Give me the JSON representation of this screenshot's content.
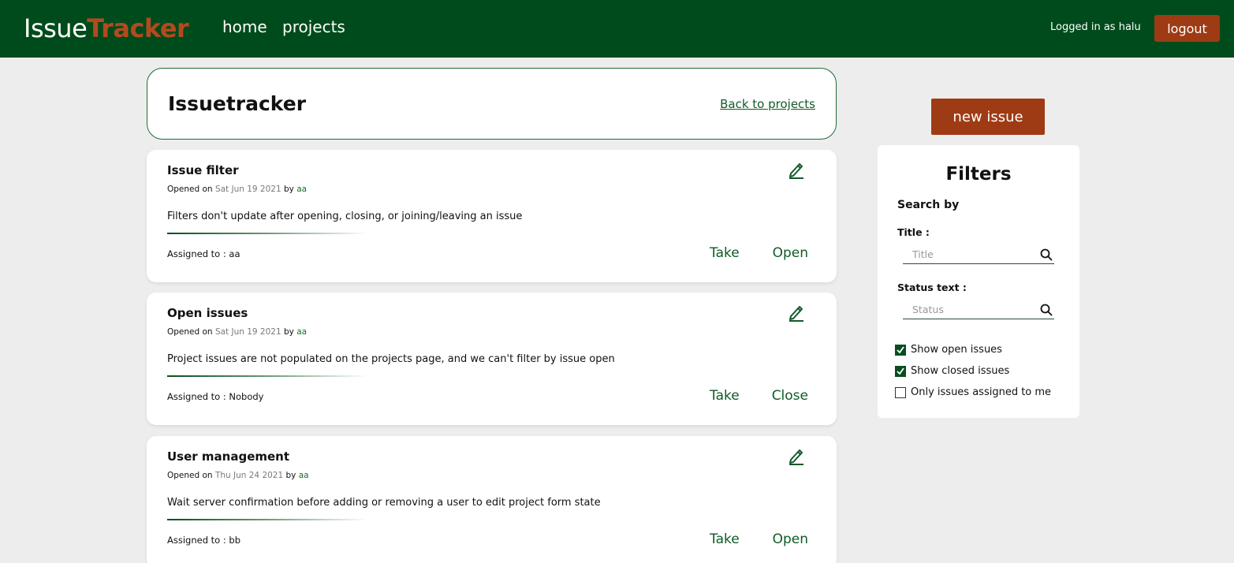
{
  "header": {
    "brand_part1": "Issue",
    "brand_part2": "Tracker",
    "nav": {
      "home": "home",
      "projects": "projects"
    },
    "logged_in_text": "Logged in as halu",
    "logout_label": "logout"
  },
  "title_card": {
    "title": "Issuetracker",
    "back_link": "Back to projects"
  },
  "issues": [
    {
      "title": "Issue filter",
      "opened_prefix": "Opened on ",
      "date": "Sat Jun 19 2021",
      "by": " by ",
      "author": "aa",
      "description": "Filters don't update after opening, closing, or joining/leaving an issue",
      "assigned": "Assigned to : aa",
      "take_label": "Take",
      "toggle_label": "Open"
    },
    {
      "title": "Open issues",
      "opened_prefix": "Opened on ",
      "date": "Sat Jun 19 2021",
      "by": " by ",
      "author": "aa",
      "description": "Project issues are not populated on the projects page, and we can't filter by issue open",
      "assigned": "Assigned to : Nobody",
      "take_label": "Take",
      "toggle_label": "Close"
    },
    {
      "title": "User management",
      "opened_prefix": "Opened on ",
      "date": "Thu Jun 24 2021",
      "by": " by ",
      "author": "aa",
      "description": "Wait server confirmation before adding or removing a user to edit project form state",
      "assigned": "Assigned to : bb",
      "take_label": "Take",
      "toggle_label": "Open"
    }
  ],
  "new_issue_label": "new issue",
  "filters": {
    "title": "Filters",
    "search_by": "Search by",
    "title_label": "Title :",
    "title_placeholder": "Title",
    "status_label": "Status text :",
    "status_placeholder": "Status",
    "checkboxes": [
      {
        "label": "Show open issues",
        "checked": true
      },
      {
        "label": "Show closed issues",
        "checked": true
      },
      {
        "label": "Only issues assigned to me",
        "checked": false
      }
    ]
  },
  "colors": {
    "header_bg": "#004b1b",
    "accent_orange": "#9e3b14",
    "link_green": "#0f5a25"
  }
}
